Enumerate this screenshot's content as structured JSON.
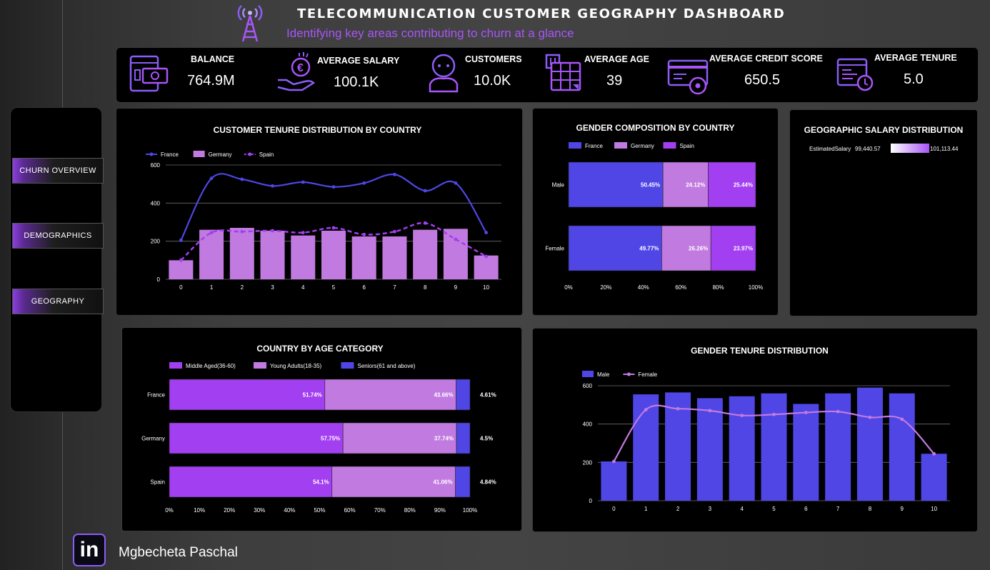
{
  "header": {
    "title": "TELECOMMUNICATION CUSTOMER GEOGRAPHY  DASHBOARD",
    "subtitle": "Identifying key areas contributing to churn at a glance"
  },
  "kpis": [
    {
      "label": "BALANCE",
      "value": "764.9M",
      "icon": "wallet-icon"
    },
    {
      "label": "AVERAGE SALARY",
      "value": "100.1K",
      "icon": "euro-hand-icon"
    },
    {
      "label": "CUSTOMERS",
      "value": "10.0K",
      "icon": "user-icon"
    },
    {
      "label": "AVERAGE AGE",
      "value": "39",
      "icon": "calendar-icon"
    },
    {
      "label": "AVERAGE CREDIT SCORE",
      "value": "650.5",
      "icon": "credit-card-icon"
    },
    {
      "label": "AVERAGE TENURE",
      "value": "5.0",
      "icon": "clock-document-icon"
    }
  ],
  "nav": [
    {
      "label": "CHURN OVERVIEW"
    },
    {
      "label": "DEMOGRAPHICS"
    },
    {
      "label": "GEOGRAPHY"
    }
  ],
  "footer": {
    "name": "Mgbecheta Paschal",
    "logo_text": "in"
  },
  "colors": {
    "blue": "#4f46e5",
    "lilac": "#c17ae0",
    "purple": "#a23ff0",
    "accent": "#a855f7"
  },
  "chart_data": [
    {
      "type": "bar",
      "title": "CUSTOMER TENURE DISTRIBUTION BY COUNTRY",
      "categories": [
        "0",
        "1",
        "2",
        "3",
        "4",
        "5",
        "6",
        "7",
        "8",
        "9",
        "10"
      ],
      "series": [
        {
          "name": "France",
          "kind": "line",
          "values": [
            205,
            530,
            525,
            490,
            510,
            485,
            505,
            550,
            465,
            505,
            245
          ]
        },
        {
          "name": "Germany",
          "kind": "bar",
          "values": [
            100,
            260,
            270,
            255,
            230,
            255,
            225,
            225,
            260,
            265,
            125
          ]
        },
        {
          "name": "Spain",
          "kind": "dashed-line",
          "values": [
            100,
            245,
            250,
            255,
            245,
            270,
            235,
            250,
            295,
            210,
            120
          ]
        }
      ],
      "yticks": [
        "0",
        "200",
        "400",
        "600"
      ],
      "ylim": [
        0,
        600
      ],
      "legend": "top-left"
    },
    {
      "type": "bar",
      "title": "GENDER COMPOSITION BY COUNTRY",
      "orientation": "horizontal-stacked",
      "categories": [
        "Male",
        "Female"
      ],
      "series": [
        {
          "name": "France",
          "values": [
            50.45,
            49.77
          ],
          "labels": [
            "50.45%",
            "49.77%"
          ]
        },
        {
          "name": "Germany",
          "values": [
            24.12,
            26.26
          ],
          "labels": [
            "24.12%",
            "26.26%"
          ]
        },
        {
          "name": "Spain",
          "values": [
            25.44,
            23.97
          ],
          "labels": [
            "25.44%",
            "23.97%"
          ]
        }
      ],
      "xticks": [
        "0%",
        "20%",
        "40%",
        "60%",
        "80%",
        "100%"
      ],
      "xlim": [
        0,
        100
      ],
      "legend": "top-left"
    },
    {
      "type": "table",
      "title": "GEOGRAPHIC SALARY DISTRIBUTION",
      "metric": "EstimatedSalary",
      "min_label": "99,440.57",
      "max_label": "101,113.44"
    },
    {
      "type": "bar",
      "title": "COUNTRY BY AGE CATEGORY",
      "orientation": "horizontal-stacked",
      "categories": [
        "France",
        "Germany",
        "Spain"
      ],
      "series": [
        {
          "name": "Middle Aged(36-60)",
          "values": [
            51.74,
            57.75,
            54.1
          ],
          "labels": [
            "51.74%",
            "57.75%",
            "54.1%"
          ]
        },
        {
          "name": "Young Adults(18-35)",
          "values": [
            43.66,
            37.74,
            41.06
          ],
          "labels": [
            "43.66%",
            "37.74%",
            "41.06%"
          ]
        },
        {
          "name": "Seniors(61 and above)",
          "values": [
            4.61,
            4.5,
            4.84
          ],
          "labels": [
            "4.61%",
            "4.5%",
            "4.84%"
          ]
        }
      ],
      "xticks": [
        "0%",
        "10%",
        "20%",
        "30%",
        "40%",
        "50%",
        "60%",
        "70%",
        "80%",
        "90%",
        "100%"
      ],
      "xlim": [
        0,
        100
      ],
      "legend": "top"
    },
    {
      "type": "bar",
      "title": "GENDER TENURE DISTRIBUTION",
      "categories": [
        "0",
        "1",
        "2",
        "3",
        "4",
        "5",
        "6",
        "7",
        "8",
        "9",
        "10"
      ],
      "series": [
        {
          "name": "Male",
          "kind": "bar",
          "values": [
            205,
            555,
            565,
            535,
            545,
            560,
            505,
            560,
            590,
            560,
            245
          ]
        },
        {
          "name": "Female",
          "kind": "line",
          "values": [
            205,
            475,
            480,
            470,
            445,
            450,
            460,
            465,
            435,
            425,
            245
          ]
        }
      ],
      "yticks": [
        "0",
        "200",
        "400",
        "600"
      ],
      "ylim": [
        0,
        600
      ],
      "legend": "top-left"
    }
  ]
}
